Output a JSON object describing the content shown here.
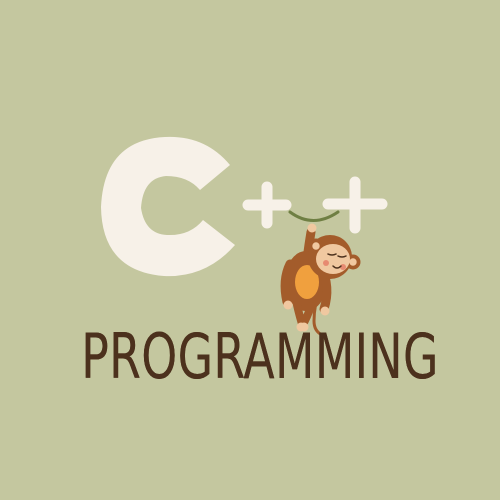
{
  "logo": {
    "title": "PROGRAMMING",
    "lettering": "C++",
    "icons": {
      "mascot": "monkey-icon"
    }
  },
  "palette": {
    "background": "#c4c79f",
    "cream": "#f7f1e8",
    "brown": "#4c311d",
    "monkey_brown": "#a35c2b",
    "monkey_orange": "#f0a03e",
    "vine": "#6f7f43",
    "face": "#f0c8a0"
  }
}
